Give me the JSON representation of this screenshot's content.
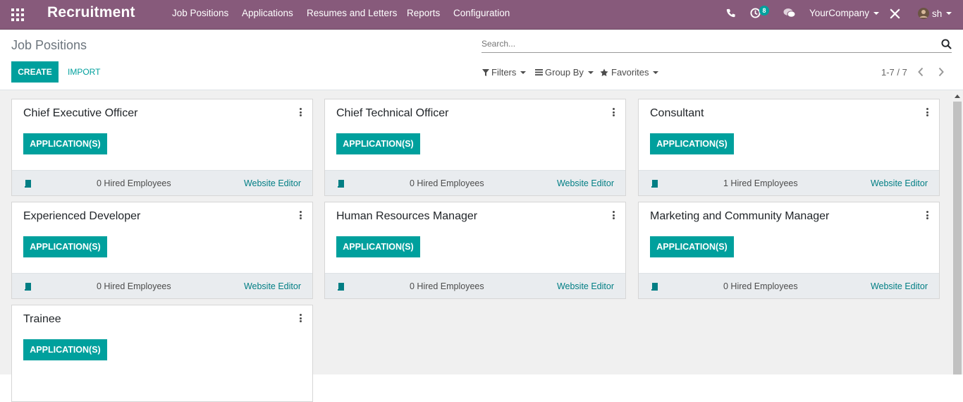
{
  "navbar": {
    "brand": "Recruitment",
    "menu": [
      "Job Positions",
      "Applications",
      "Resumes and Letters",
      "Reports",
      "Configuration"
    ],
    "activity_count": "8",
    "company": "YourCompany",
    "user": "sh",
    "icons": [
      "apps-grid-icon",
      "phone-icon",
      "clock-icon",
      "chat-icon",
      "debug-icon",
      "avatar"
    ]
  },
  "control": {
    "title": "Job Positions",
    "create_label": "CREATE",
    "import_label": "IMPORT",
    "search_placeholder": "Search...",
    "filters_label": "Filters",
    "groupby_label": "Group By",
    "favorites_label": "Favorites",
    "pager": "1-7 / 7"
  },
  "cards": [
    {
      "name": "Chief Executive Officer",
      "button": "APPLICATION(S)",
      "hired": "0 Hired Employees",
      "website": "Website Editor"
    },
    {
      "name": "Chief Technical Officer",
      "button": "APPLICATION(S)",
      "hired": "0 Hired Employees",
      "website": "Website Editor"
    },
    {
      "name": "Consultant",
      "button": "APPLICATION(S)",
      "hired": "1 Hired Employees",
      "website": "Website Editor"
    },
    {
      "name": "Experienced Developer",
      "button": "APPLICATION(S)",
      "hired": "0 Hired Employees",
      "website": "Website Editor"
    },
    {
      "name": "Human Resources Manager",
      "button": "APPLICATION(S)",
      "hired": "0 Hired Employees",
      "website": "Website Editor"
    },
    {
      "name": "Marketing and Community Manager",
      "button": "APPLICATION(S)",
      "hired": "0 Hired Employees",
      "website": "Website Editor"
    },
    {
      "name": "Trainee",
      "button": "APPLICATION(S)",
      "hired": "",
      "website": ""
    }
  ],
  "colors": {
    "navbar": "#875a7b",
    "accent": "#00a09d",
    "link": "#017e84"
  }
}
